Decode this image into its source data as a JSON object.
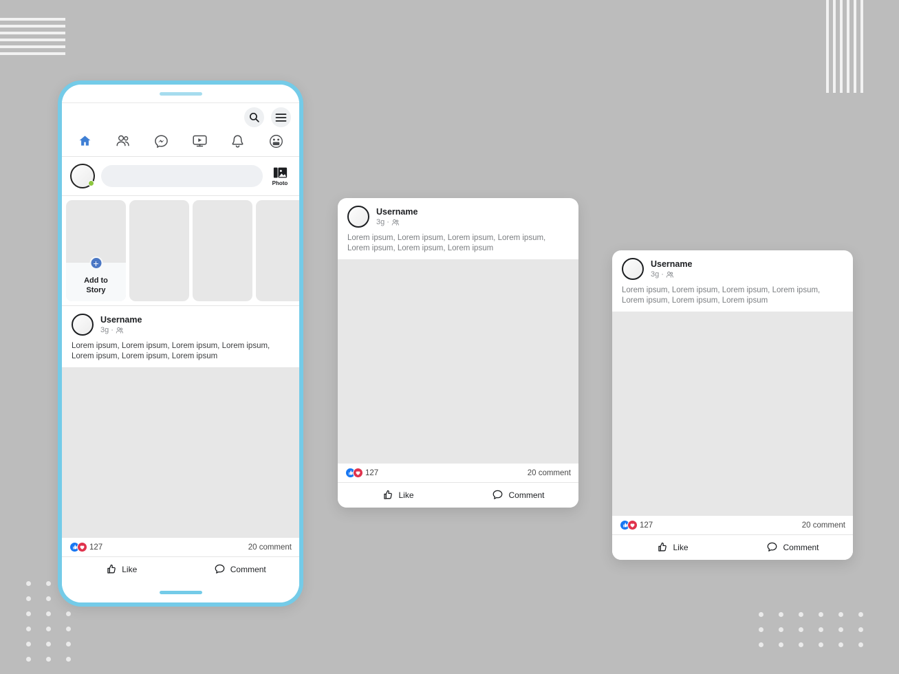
{
  "theme": {
    "page_background": "#bcbcbc",
    "phone_frame": "#74cbe8",
    "accent_blue": "#1877f2",
    "nav_active_blue": "#3f7fd4",
    "reaction_like": "#1877f2",
    "reaction_love": "#e0334d",
    "online_green": "#8dc63f",
    "placeholder_gray": "#e7e7e7"
  },
  "phone": {
    "topbar": {
      "search_icon": "search-icon",
      "menu_icon": "hamburger-menu-icon"
    },
    "nav": [
      {
        "name": "home",
        "icon": "home-icon",
        "active": true
      },
      {
        "name": "friends",
        "icon": "friends-icon",
        "active": false
      },
      {
        "name": "messenger",
        "icon": "messenger-icon",
        "active": false
      },
      {
        "name": "watch",
        "icon": "video-play-icon",
        "active": false
      },
      {
        "name": "notifications",
        "icon": "bell-icon",
        "active": false
      },
      {
        "name": "groups",
        "icon": "groups-icon",
        "active": false
      }
    ],
    "composer": {
      "placeholder": "",
      "value": "",
      "photo_label": "Photo",
      "photo_icon": "photo-icon",
      "avatar_icon": "user-avatar",
      "online_status": "online"
    },
    "stories": {
      "add_label_line1": "Add to",
      "add_label_line2": "Story",
      "plus_icon": "plus-circle-icon",
      "placeholders": 3
    },
    "post": {
      "username": "Username",
      "time": "3g",
      "separator": "·",
      "audience_icon": "friends-audience-icon",
      "body": "Lorem ipsum, Lorem ipsum, Lorem ipsum, Lorem ipsum, Lorem ipsum, Lorem ipsum, Lorem ipsum",
      "reaction_count": "127",
      "comment_count": "20 comment",
      "like_label": "Like",
      "like_icon": "thumbs-up-icon",
      "comment_label": "Comment",
      "comment_icon": "speech-bubble-icon"
    }
  },
  "card_middle": {
    "username": "Username",
    "time": "3g",
    "separator": "·",
    "audience_icon": "friends-audience-icon",
    "body": "Lorem ipsum, Lorem ipsum, Lorem ipsum, Lorem ipsum, Lorem ipsum, Lorem ipsum, Lorem ipsum",
    "reaction_count": "127",
    "comment_count": "20 comment",
    "like_label": "Like",
    "like_icon": "thumbs-up-icon",
    "comment_label": "Comment",
    "comment_icon": "speech-bubble-icon"
  },
  "card_right": {
    "username": "Username",
    "time": "3g",
    "separator": "·",
    "audience_icon": "friends-audience-icon",
    "body": "Lorem ipsum, Lorem ipsum, Lorem ipsum, Lorem ipsum, Lorem ipsum, Lorem ipsum, Lorem ipsum",
    "reaction_count": "127",
    "comment_count": "20 comment",
    "like_label": "Like",
    "like_icon": "thumbs-up-icon",
    "comment_label": "Comment",
    "comment_icon": "speech-bubble-icon"
  },
  "decor": {
    "horizontal_lines_count": 6,
    "vertical_lines_count": 6,
    "dots_bottom_left_cols": 3,
    "dots_bottom_left_rows": 6,
    "dots_bottom_right_cols": 6,
    "dots_bottom_right_rows": 3
  }
}
